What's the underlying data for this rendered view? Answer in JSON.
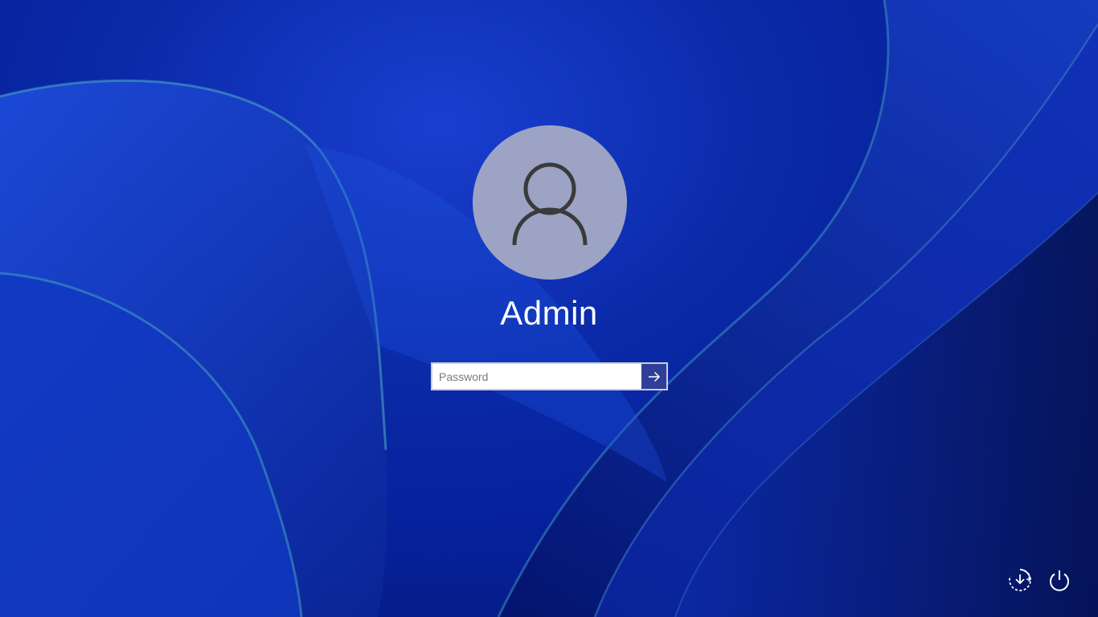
{
  "login": {
    "username": "Admin",
    "password_placeholder": "Password",
    "password_value": ""
  },
  "icons": {
    "avatar": "user-silhouette-icon",
    "submit": "arrow-right-icon",
    "accessibility": "accessibility-icon",
    "power": "power-icon"
  },
  "colors": {
    "accent": "#2f3e98",
    "avatar_bg": "#9ca3c4",
    "text": "#ffffff"
  }
}
